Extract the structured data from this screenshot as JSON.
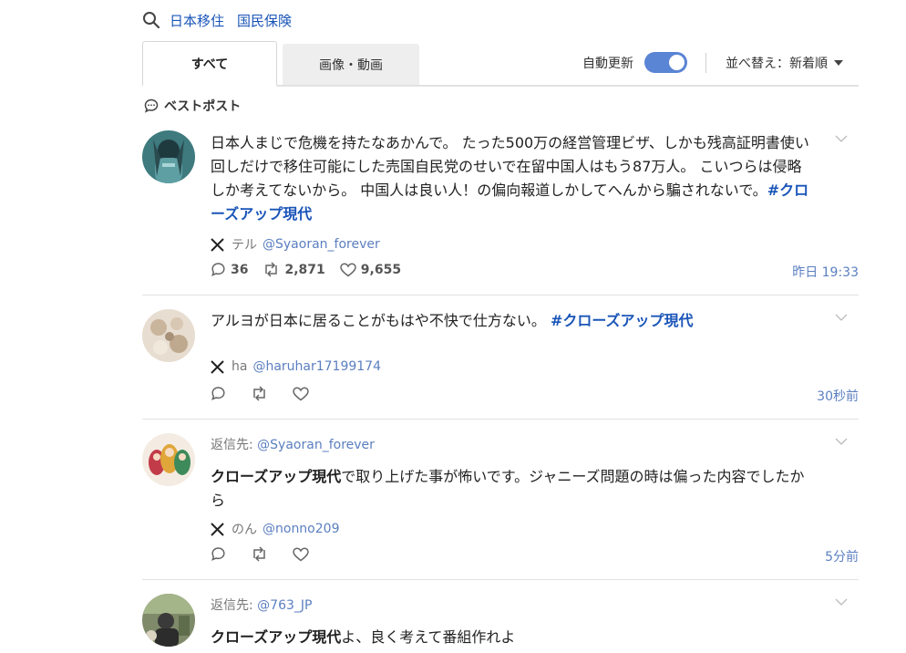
{
  "search": {
    "keywords": [
      "日本移住",
      "国民保険"
    ]
  },
  "tabs": {
    "all": "すべて",
    "media": "画像・動画"
  },
  "controls": {
    "auto_update_label": "自動更新",
    "auto_update_on": true,
    "sort_label": "並べ替え：新着順"
  },
  "section": {
    "best_posts": "ベストポスト"
  },
  "colors": {
    "link": "#1a55b8",
    "toggle": "#5a84d4",
    "handle": "#5b7fc0"
  },
  "posts": [
    {
      "text": "日本人まじで危機を持たなあかんで。 たった500万の経営管理ビザ、しかも残高証明書使い回しだけで移住可能にした売国自民党のせいで在留中国人はもう87万人。 こいつらは侵略しか考えてないから。 中国人は良い人！の偏向報道しかしてへんから騙されないで。",
      "hashtag": "#クローズアップ現代",
      "author_name": "テル",
      "author_handle": "@Syaoran_forever",
      "replies": "36",
      "reposts": "2,871",
      "likes": "9,655",
      "time": "昨日 19:33"
    },
    {
      "text": "アルヨが日本に居ることがもはや不快で仕方ない。",
      "hashtag": "#クローズアップ現代",
      "author_name": "ha",
      "author_handle": "@haruhar17199174",
      "time": "30秒前"
    },
    {
      "reply_prefix": "返信先:",
      "reply_to": "@Syaoran_forever",
      "bold_text": "クローズアップ現代",
      "text": "で取り上げた事が怖いです。ジャニーズ問題の時は偏った内容でしたから",
      "author_name": "のん",
      "author_handle": "@nonno209",
      "time": "5分前"
    },
    {
      "reply_prefix": "返信先:",
      "reply_to": "@763_JP",
      "bold_text": "クローズアップ現代",
      "text": "よ、良く考えて番組作れよ"
    }
  ]
}
